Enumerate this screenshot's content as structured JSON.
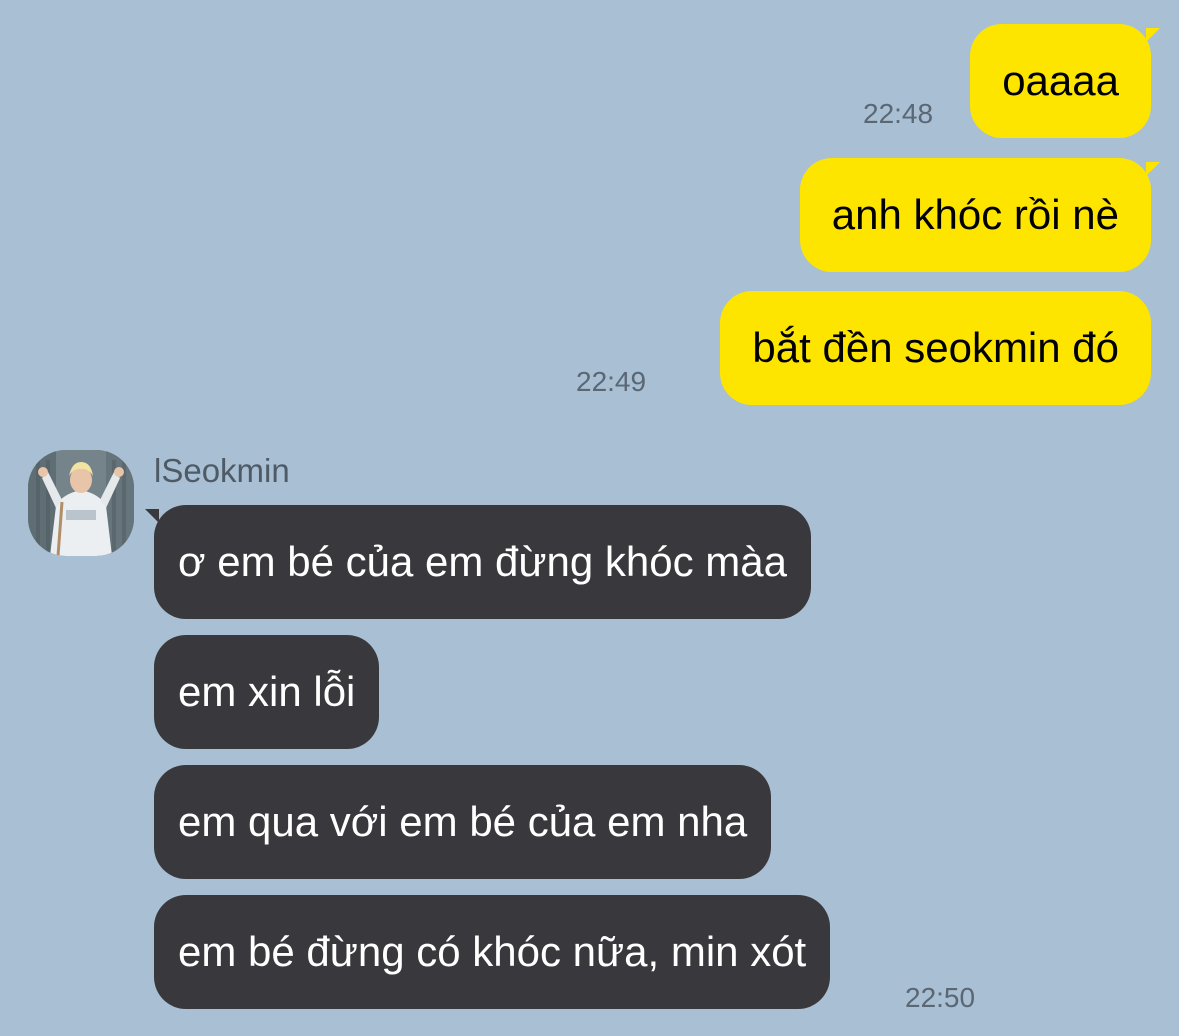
{
  "chat": {
    "contact_name": "lSeokmin",
    "outgoing": [
      {
        "text": "oaaaa",
        "time": "22:48"
      },
      {
        "text": "anh khóc rồi nè",
        "time": ""
      },
      {
        "text": "bắt đền seokmin đó",
        "time": "22:49"
      }
    ],
    "incoming": [
      {
        "text": "ơ em bé của em đừng khóc màa",
        "time": ""
      },
      {
        "text": "em xin lỗi",
        "time": ""
      },
      {
        "text": "em qua với em bé của em nha",
        "time": ""
      },
      {
        "text": "em bé đừng có khóc nữa, min xót",
        "time": "22:50"
      }
    ]
  },
  "colors": {
    "background": "#a9bfd3",
    "outgoing_bubble": "#fee500",
    "incoming_bubble": "#39383d",
    "timestamp": "#5a6774"
  }
}
